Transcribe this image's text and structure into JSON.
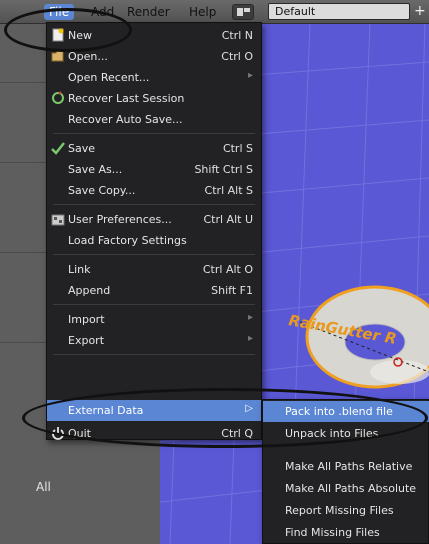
{
  "header": {
    "menus": [
      "File",
      "Add",
      "Render",
      "Help"
    ],
    "layout_name": "Default",
    "add_symbol": "+"
  },
  "background": {
    "left_panel_label": "All",
    "viewport_logo_text": "RainGutter R",
    "viewport_color": "#5a58d4"
  },
  "file_menu": {
    "new": {
      "label": "New",
      "shortcut": "Ctrl N"
    },
    "open": {
      "label": "Open...",
      "shortcut": "Ctrl O"
    },
    "open_recent": {
      "label": "Open Recent...",
      "arrow": "▸"
    },
    "recover_last": {
      "label": "Recover Last Session"
    },
    "recover_auto": {
      "label": "Recover Auto Save..."
    },
    "save": {
      "label": "Save",
      "shortcut": "Ctrl S"
    },
    "save_as": {
      "label": "Save As...",
      "shortcut": "Shift Ctrl S"
    },
    "save_copy": {
      "label": "Save Copy...",
      "shortcut": "Ctrl Alt S"
    },
    "user_prefs": {
      "label": "User Preferences...",
      "shortcut": "Ctrl Alt U"
    },
    "load_factory": {
      "label": "Load Factory Settings"
    },
    "link": {
      "label": "Link",
      "shortcut": "Ctrl Alt O"
    },
    "append": {
      "label": "Append",
      "shortcut": "Shift F1"
    },
    "import": {
      "label": "Import",
      "arrow": "▸"
    },
    "export": {
      "label": "Export",
      "arrow": "▸"
    },
    "external_data": {
      "label": "External Data",
      "arrow": "▷"
    },
    "quit": {
      "label": "Quit",
      "shortcut": "Ctrl Q"
    }
  },
  "external_data_menu": {
    "items": [
      "Pack into .blend file",
      "Unpack into Files",
      "Make All Paths Relative",
      "Make All Paths Absolute",
      "Report Missing Files",
      "Find Missing Files"
    ]
  },
  "colors": {
    "highlight": "#5a86d3",
    "menu_bg": "#222224"
  }
}
